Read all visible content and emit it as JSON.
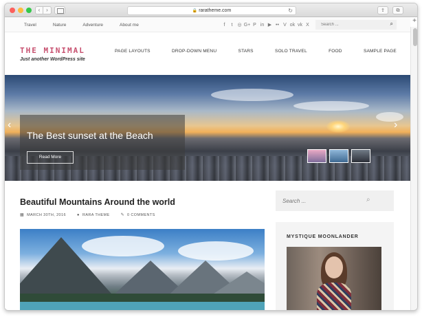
{
  "browser": {
    "url": "raratheme.com",
    "back_glyph": "‹",
    "forward_glyph": "›",
    "reload_glyph": "↻",
    "share_glyph": "⇪",
    "tabs_glyph": "⧉",
    "new_tab_glyph": "+"
  },
  "top_nav": {
    "items": [
      "Travel",
      "Nature",
      "Adventure",
      "About me"
    ]
  },
  "social_icons": [
    "facebook-icon",
    "twitter-icon",
    "instagram-icon",
    "google-plus-icon",
    "pinterest-icon",
    "linkedin-icon",
    "youtube-icon",
    "flickr-icon",
    "vimeo-icon",
    "odnoklassniki-icon",
    "vk-icon",
    "xing-icon"
  ],
  "social_glyphs": [
    "f",
    "t",
    "◎",
    "G+",
    "P",
    "in",
    "▶",
    "••",
    "V",
    "ok",
    "vk",
    "X"
  ],
  "top_search": {
    "placeholder": "Search ...",
    "icon": "search-icon",
    "icon_glyph": "⌕"
  },
  "site": {
    "title": "THE MINIMAL",
    "tagline": "Just another WordPress site",
    "brand_color": "#c7506f"
  },
  "main_nav": {
    "items": [
      "PAGE LAYOUTS",
      "DROP-DOWN MENU",
      "STARS",
      "SOLO TRAVEL",
      "FOOD",
      "SAMPLE PAGE"
    ]
  },
  "slider": {
    "caption_title": "The Best sunset at the Beach",
    "read_more": "Read More",
    "prev_glyph": "‹",
    "next_glyph": "›"
  },
  "post": {
    "title": "Beautiful Mountains Around the world",
    "date": "MARCH 30TH, 2016",
    "author": "RARA THEME",
    "comments": "0 COMMENTS",
    "date_icon": "calendar-icon",
    "author_icon": "user-icon",
    "comments_icon": "pencil-icon",
    "date_glyph": "▦",
    "author_glyph": "●",
    "comments_glyph": "✎"
  },
  "sidebar": {
    "search_placeholder": "Search ...",
    "search_icon_glyph": "⌕",
    "widget_title": "MYSTIQUE MOONLANDER"
  }
}
